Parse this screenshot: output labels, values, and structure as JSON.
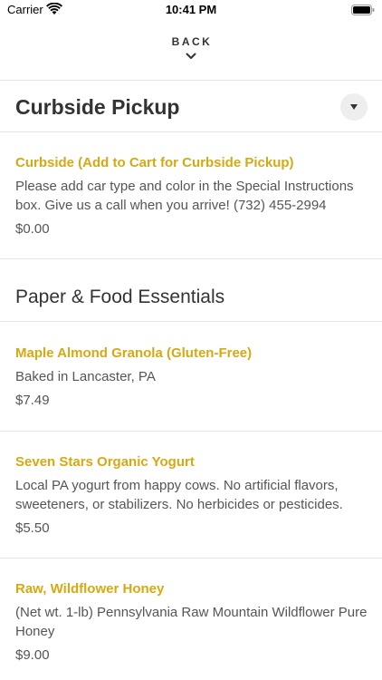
{
  "status_bar": {
    "carrier": "Carrier",
    "time": "10:41 PM",
    "wifi_icon": "wifi-icon",
    "battery_icon": "battery-icon"
  },
  "header": {
    "back_label": "BACK",
    "back_icon": "chevron-down-icon"
  },
  "colors": {
    "accent": "#d6a913",
    "text": "#333333",
    "muted": "#555555",
    "divider": "#e6e6e6"
  },
  "sections": [
    {
      "title": "Curbside Pickup",
      "collapse_icon": "caret-down-icon",
      "items": [
        {
          "name": "Curbside (Add to Cart for Curbside Pickup)",
          "description": "Please add car type and color in the Special Instructions box. Give us a call when you arrive! (732) 455-2994",
          "price": "$0.00"
        }
      ]
    },
    {
      "title": "Paper & Food Essentials",
      "items": [
        {
          "name": "Maple Almond Granola (Gluten-Free)",
          "description": "Baked in Lancaster, PA",
          "price": "$7.49"
        },
        {
          "name": "Seven Stars Organic Yogurt",
          "description": "Local PA yogurt from happy cows. No artificial flavors, sweeteners, or stabilizers. No herbicides or pesticides.",
          "price": "$5.50"
        },
        {
          "name": "Raw, Wildflower Honey",
          "description": "(Net wt. 1-lb) Pennsylvania Raw Mountain Wildflower Pure Honey",
          "price": "$9.00"
        }
      ]
    }
  ]
}
